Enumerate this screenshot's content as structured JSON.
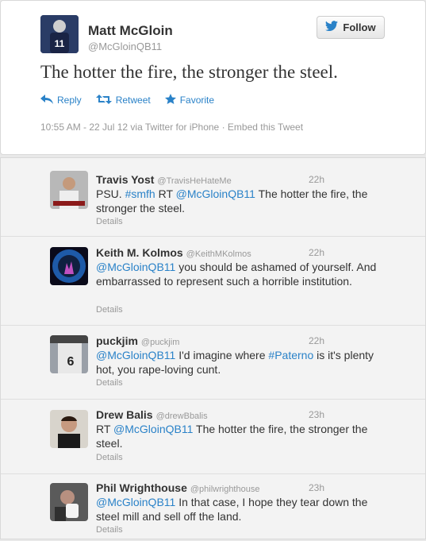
{
  "main_tweet": {
    "name": "Matt McGloin",
    "handle": "@McGloinQB11",
    "follow_label": "Follow",
    "text": "The hotter the fire, the stronger the steel.",
    "actions": {
      "reply": "Reply",
      "retweet": "Retweet",
      "favorite": "Favorite"
    },
    "meta": "10:55 AM - 22 Jul 12 via Twitter for iPhone · Embed this Tweet"
  },
  "replies": [
    {
      "name": "Travis Yost",
      "handle": "@TravisHeHateMe",
      "time": "22h",
      "segments": [
        [
          "PSU. ",
          false
        ],
        [
          "#smfh",
          true
        ],
        [
          " RT ",
          false
        ],
        [
          "@McGloinQB11",
          true
        ],
        [
          " The hotter the fire, the stronger the steel.",
          false
        ]
      ],
      "details": "Details"
    },
    {
      "name": "Keith M. Kolmos",
      "handle": "@KeithMKolmos",
      "time": "22h",
      "segments": [
        [
          "@McGloinQB11",
          true
        ],
        [
          " you should be ashamed of yourself. And embarrassed to represent such a horrible institution.",
          false
        ]
      ],
      "details": "Details"
    },
    {
      "name": "puckjim",
      "handle": "@puckjim",
      "time": "22h",
      "segments": [
        [
          "@McGloinQB11",
          true
        ],
        [
          " I'd imagine where ",
          false
        ],
        [
          "#Paterno",
          true
        ],
        [
          " is it's plenty hot, you rape-loving cunt.",
          false
        ]
      ],
      "details": "Details"
    },
    {
      "name": "Drew Balis",
      "handle": "@drewBbalis",
      "time": "23h",
      "segments": [
        [
          "RT ",
          false
        ],
        [
          "@McGloinQB11",
          true
        ],
        [
          " The hotter the fire, the stronger the steel.",
          false
        ]
      ],
      "details": "Details"
    },
    {
      "name": "Phil Wrighthouse",
      "handle": "@philwrighthouse",
      "time": "23h",
      "segments": [
        [
          "@McGloinQB11",
          true
        ],
        [
          " In that case, I hope they tear down the steel mill and sell off the land.",
          false
        ]
      ],
      "details": "Details"
    }
  ]
}
